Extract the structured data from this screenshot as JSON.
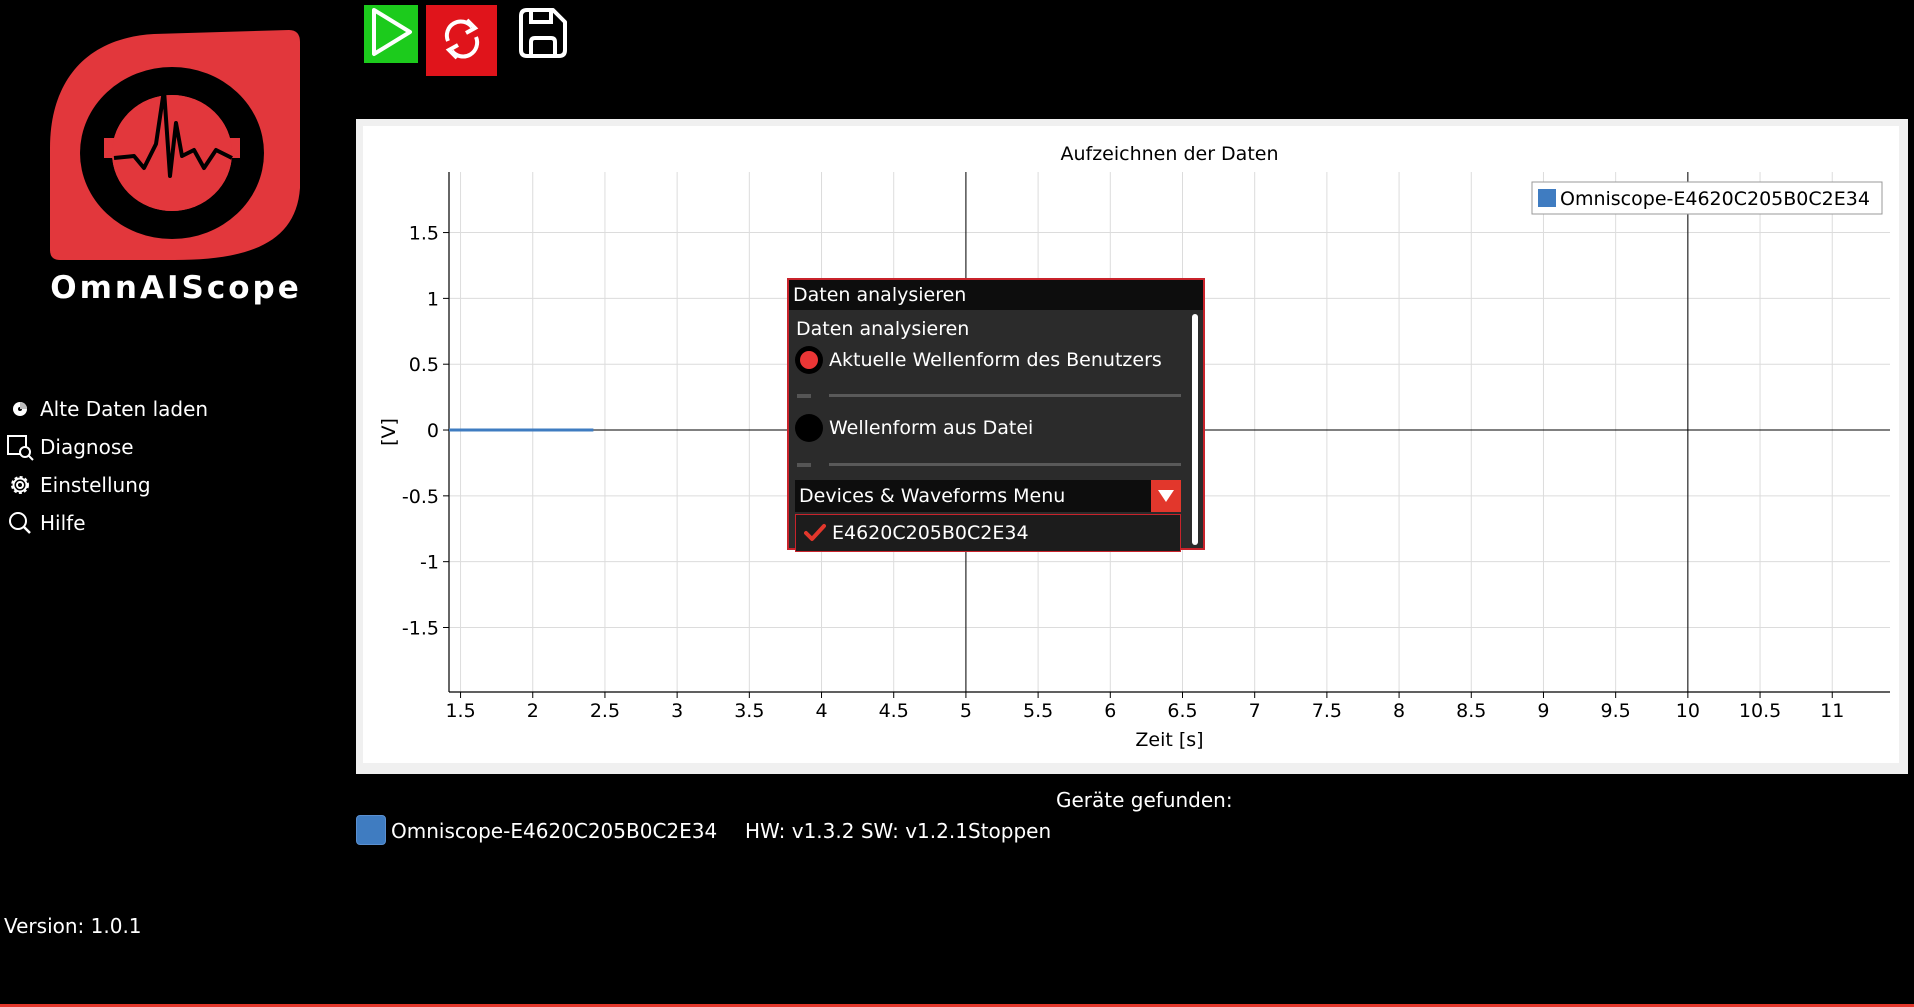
{
  "brand": {
    "name": "OmnAIScope"
  },
  "sidebar": {
    "items": [
      {
        "label": "Alte Daten laden",
        "icon": "disk-icon"
      },
      {
        "label": "Diagnose",
        "icon": "diagnose-icon"
      },
      {
        "label": "Einstellung",
        "icon": "gear-icon"
      },
      {
        "label": "Hilfe",
        "icon": "search-icon"
      }
    ],
    "version": "Version: 1.0.1"
  },
  "toolbar": {
    "start_icon": "play-icon",
    "refresh_icon": "refresh-icon",
    "save_icon": "save-icon"
  },
  "chart_data": {
    "type": "line",
    "title": "Aufzeichnen der Daten",
    "xlabel": "Zeit [s]",
    "ylabel": "[V]",
    "xlim": [
      1.42,
      11.4
    ],
    "ylim": [
      -1.99,
      1.96
    ],
    "xticks": [
      1.5,
      2,
      2.5,
      3,
      3.5,
      4,
      4.5,
      5,
      5.5,
      6,
      6.5,
      7,
      7.5,
      8,
      8.5,
      9,
      9.5,
      10,
      10.5,
      11
    ],
    "xtick_labels": [
      "1.5",
      "2",
      "2.5",
      "3",
      "3.5",
      "4",
      "4.5",
      "5",
      "5.5",
      "6",
      "6.5",
      "7",
      "7.5",
      "8",
      "8.5",
      "9",
      "9.5",
      "10",
      "10.5",
      "11"
    ],
    "yticks": [
      1.5,
      1,
      0.5,
      0,
      -0.5,
      -1,
      -1.5
    ],
    "ytick_labels": [
      "1.5",
      "1",
      "0.5",
      "0",
      "-0.5",
      "-1",
      "-1.5"
    ],
    "grid": true,
    "legend": "top-right",
    "series": [
      {
        "name": "Omniscope-E4620C205B0C2E34",
        "color": "#3f7cc1",
        "x": [
          1.42,
          1.6,
          1.8,
          2.0,
          2.2,
          2.42
        ],
        "y": [
          0,
          0,
          0,
          0,
          0,
          0
        ]
      }
    ]
  },
  "dialog": {
    "title": "Daten analysieren",
    "heading": "Daten analysieren",
    "option_user": "Aktuelle Wellenform des Benutzers",
    "option_file": "Wellenform aus Datei",
    "dropdown_label": "Devices & Waveforms Menu",
    "device_item": "E4620C205B0C2E34",
    "accent": "#e2372c"
  },
  "devices": {
    "found_label": "Geräte gefunden:",
    "items": [
      {
        "name": "Omniscope-E4620C205B0C2E34",
        "hw_sw": "HW: v1.3.2 SW: v1.2.1",
        "action": "Stoppen",
        "color": "#3f7cc1"
      }
    ]
  }
}
